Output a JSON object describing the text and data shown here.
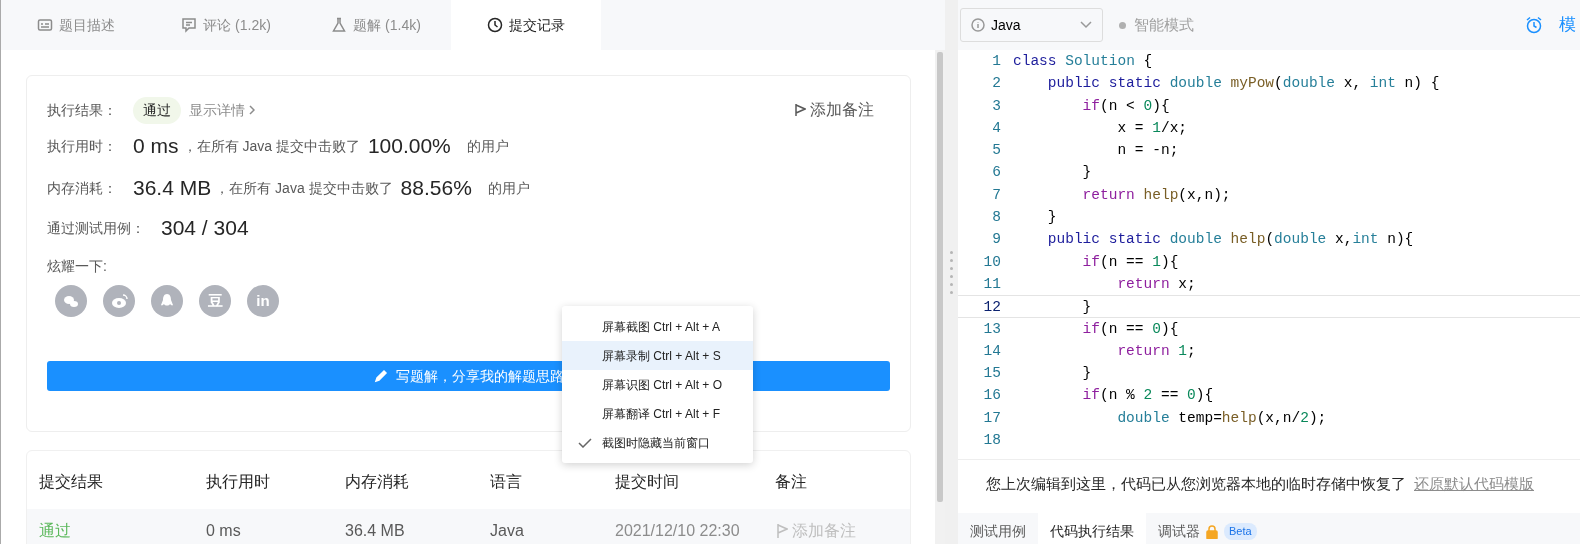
{
  "left_tabs": [
    {
      "label": "题目描述",
      "kind": "description",
      "selected": false
    },
    {
      "label": "评论 (1.2k)",
      "kind": "comments",
      "selected": false
    },
    {
      "label": "题解 (1.4k)",
      "kind": "solutions",
      "selected": false
    },
    {
      "label": "提交记录",
      "kind": "submissions",
      "selected": true
    }
  ],
  "result": {
    "label": "执行结果：",
    "status": "通过",
    "details_link": "显示详情",
    "note_button": "添加备注",
    "stats": [
      {
        "label": "执行用时：",
        "value": "0 ms",
        "text": "，在所有 Java 提交中击败了",
        "percent": "100.00%",
        "suffix": "的用户"
      },
      {
        "label": "内存消耗：",
        "value": "36.4 MB",
        "text": "，在所有 Java 提交中击败了",
        "percent": "88.56%",
        "suffix": "的用户"
      }
    ],
    "tests": {
      "label": "通过测试用例：",
      "value": "304 / 304"
    },
    "share_label": "炫耀一下:",
    "share": [
      {
        "kind": "bubbles"
      },
      {
        "kind": "swirl"
      },
      {
        "kind": "figure"
      },
      {
        "kind": "glyph",
        "glyph": "豆"
      },
      {
        "kind": "glyph",
        "glyph": "in"
      }
    ],
    "write_button": "写题解，分享我的解题思路"
  },
  "table": {
    "columns": [
      "提交结果",
      "执行用时",
      "内存消耗",
      "语言",
      "提交时间",
      "备注"
    ],
    "rows": [
      {
        "status": "通过",
        "runtime": "0 ms",
        "memory": "36.4 MB",
        "language": "Java",
        "time": "2021/12/10 22:30",
        "note": "添加备注"
      }
    ]
  },
  "context_menu": [
    {
      "label": "屏幕截图 Ctrl + Alt + A",
      "highlighted": false,
      "checked": false
    },
    {
      "label": "屏幕录制 Ctrl + Alt + S",
      "highlighted": true,
      "checked": false
    },
    {
      "label": "屏幕识图 Ctrl + Alt + O",
      "highlighted": false,
      "checked": false
    },
    {
      "label": "屏幕翻译 Ctrl + Alt + F",
      "highlighted": false,
      "checked": false
    },
    {
      "label": "截图时隐藏当前窗口",
      "highlighted": false,
      "checked": true
    }
  ],
  "editor": {
    "language": "Java",
    "mode": "智能模式",
    "mode_on": false,
    "right_label": "模",
    "lines": [
      {
        "number": "1",
        "current": false,
        "tokens": [
          {
            "kind": "keyword",
            "text": "class "
          },
          {
            "kind": "type",
            "text": "Solution"
          },
          {
            "kind": "plain",
            "text": " {"
          }
        ]
      },
      {
        "number": "2",
        "current": false,
        "tokens": [
          {
            "kind": "keyword",
            "text": "    public static "
          },
          {
            "kind": "type",
            "text": "double "
          },
          {
            "kind": "function",
            "text": "myPow"
          },
          {
            "kind": "plain",
            "text": "("
          },
          {
            "kind": "type",
            "text": "double"
          },
          {
            "kind": "plain",
            "text": " x, "
          },
          {
            "kind": "type",
            "text": "int"
          },
          {
            "kind": "plain",
            "text": " n) {"
          }
        ]
      },
      {
        "number": "3",
        "current": false,
        "tokens": [
          {
            "kind": "control",
            "text": "        if"
          },
          {
            "kind": "plain",
            "text": "(n < "
          },
          {
            "kind": "number",
            "text": "0"
          },
          {
            "kind": "plain",
            "text": "){"
          }
        ]
      },
      {
        "number": "4",
        "current": false,
        "tokens": [
          {
            "kind": "plain",
            "text": "            x = "
          },
          {
            "kind": "number",
            "text": "1"
          },
          {
            "kind": "plain",
            "text": "/x;"
          }
        ]
      },
      {
        "number": "5",
        "current": false,
        "tokens": [
          {
            "kind": "plain",
            "text": "            n = -n;"
          }
        ]
      },
      {
        "number": "6",
        "current": false,
        "tokens": [
          {
            "kind": "plain",
            "text": "        }"
          }
        ]
      },
      {
        "number": "7",
        "current": false,
        "tokens": [
          {
            "kind": "control",
            "text": "        return "
          },
          {
            "kind": "function",
            "text": "help"
          },
          {
            "kind": "plain",
            "text": "(x,n);"
          }
        ]
      },
      {
        "number": "8",
        "current": false,
        "tokens": [
          {
            "kind": "plain",
            "text": "    }"
          }
        ]
      },
      {
        "number": "9",
        "current": false,
        "tokens": [
          {
            "kind": "keyword",
            "text": "    public static "
          },
          {
            "kind": "type",
            "text": "double "
          },
          {
            "kind": "function",
            "text": "help"
          },
          {
            "kind": "plain",
            "text": "("
          },
          {
            "kind": "type",
            "text": "double"
          },
          {
            "kind": "plain",
            "text": " x,"
          },
          {
            "kind": "type",
            "text": "int"
          },
          {
            "kind": "plain",
            "text": " n){"
          }
        ]
      },
      {
        "number": "10",
        "current": false,
        "tokens": [
          {
            "kind": "control",
            "text": "        if"
          },
          {
            "kind": "plain",
            "text": "(n == "
          },
          {
            "kind": "number",
            "text": "1"
          },
          {
            "kind": "plain",
            "text": "){"
          }
        ]
      },
      {
        "number": "11",
        "current": false,
        "tokens": [
          {
            "kind": "control",
            "text": "            return"
          },
          {
            "kind": "plain",
            "text": " x;"
          }
        ]
      },
      {
        "number": "12",
        "current": true,
        "tokens": [
          {
            "kind": "plain",
            "text": "        }"
          }
        ]
      },
      {
        "number": "13",
        "current": false,
        "tokens": [
          {
            "kind": "control",
            "text": "        if"
          },
          {
            "kind": "plain",
            "text": "(n == "
          },
          {
            "kind": "number",
            "text": "0"
          },
          {
            "kind": "plain",
            "text": "){"
          }
        ]
      },
      {
        "number": "14",
        "current": false,
        "tokens": [
          {
            "kind": "control",
            "text": "            return "
          },
          {
            "kind": "number",
            "text": "1"
          },
          {
            "kind": "plain",
            "text": ";"
          }
        ]
      },
      {
        "number": "15",
        "current": false,
        "tokens": [
          {
            "kind": "plain",
            "text": "        }"
          }
        ]
      },
      {
        "number": "16",
        "current": false,
        "tokens": [
          {
            "kind": "control",
            "text": "        if"
          },
          {
            "kind": "plain",
            "text": "(n % "
          },
          {
            "kind": "number",
            "text": "2"
          },
          {
            "kind": "plain",
            "text": " == "
          },
          {
            "kind": "number",
            "text": "0"
          },
          {
            "kind": "plain",
            "text": "){"
          }
        ]
      },
      {
        "number": "17",
        "current": false,
        "tokens": [
          {
            "kind": "type",
            "text": "            double"
          },
          {
            "kind": "plain",
            "text": " temp="
          },
          {
            "kind": "function",
            "text": "help"
          },
          {
            "kind": "plain",
            "text": "(x,n/"
          },
          {
            "kind": "number",
            "text": "2"
          },
          {
            "kind": "plain",
            "text": ");"
          }
        ]
      },
      {
        "number": "18",
        "current": false
      }
    ],
    "restore_message": "您上次编辑到这里，代码已从您浏览器本地的临时存储中恢复了",
    "restore_link": "还原默认代码模版",
    "bottom_tabs": [
      {
        "label": "测试用例",
        "selected": false
      },
      {
        "label": "代码执行结果",
        "selected": true
      },
      {
        "label": "调试器",
        "selected": false,
        "locked": true,
        "badge": "Beta"
      }
    ]
  }
}
